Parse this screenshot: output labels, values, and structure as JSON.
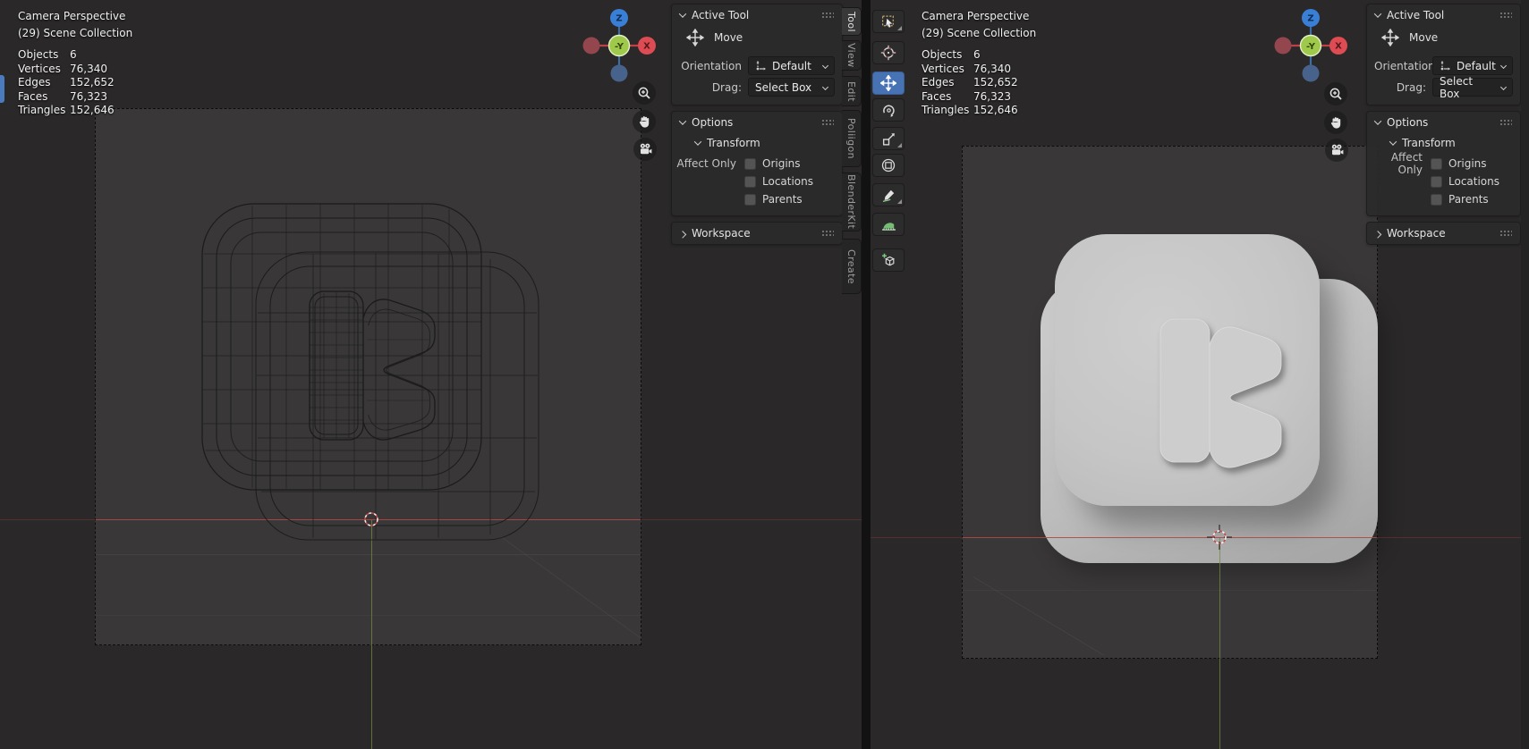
{
  "viewport": {
    "view_name": "Camera Perspective",
    "collection": "(29) Scene Collection",
    "stats": [
      {
        "label": "Objects",
        "value": "6"
      },
      {
        "label": "Vertices",
        "value": "76,340"
      },
      {
        "label": "Edges",
        "value": "152,652"
      },
      {
        "label": "Faces",
        "value": "76,323"
      },
      {
        "label": "Triangles",
        "value": "152,646"
      }
    ],
    "gizmo": {
      "z": "Z",
      "x": "X",
      "front": "-Y"
    }
  },
  "panel": {
    "active_tool": {
      "title": "Active Tool",
      "tool_name": "Move",
      "orientation_label": "Orientation",
      "orientation_value": "Default",
      "drag_label": "Drag:",
      "drag_value": "Select Box"
    },
    "options": {
      "title": "Options",
      "transform_title": "Transform",
      "affect_only_label": "Affect Only",
      "checkboxes": [
        {
          "label": "Origins",
          "checked": false
        },
        {
          "label": "Locations",
          "checked": false
        },
        {
          "label": "Parents",
          "checked": false
        }
      ]
    },
    "workspace": {
      "title": "Workspace"
    }
  },
  "tabs": [
    {
      "label": "Tool",
      "active": true
    },
    {
      "label": "View",
      "active": false
    },
    {
      "label": "Edit",
      "active": false
    },
    {
      "label": "Poliigon",
      "active": false
    },
    {
      "label": "BlenderKit",
      "active": false
    },
    {
      "label": "Create",
      "active": false
    }
  ],
  "toolbar": {
    "tools": [
      {
        "name": "select-box",
        "active": false
      },
      {
        "name": "cursor",
        "active": false
      },
      {
        "name": "move",
        "active": true
      },
      {
        "name": "rotate",
        "active": false
      },
      {
        "name": "scale",
        "active": false
      },
      {
        "name": "transform",
        "active": false
      },
      {
        "name": "annotate",
        "active": false
      },
      {
        "name": "measure",
        "active": false
      },
      {
        "name": "add-cube",
        "active": false
      }
    ]
  },
  "colors": {
    "toolbar_active": "#4772b3",
    "axis_x_ball": "#dd4b53",
    "axis_z_ball": "#3a7fd6",
    "axis_front_ball": "#9fc94a",
    "floor_line_x": "#a34743",
    "floor_line_y": "#6d8f3e",
    "model_gray": "#c8c8c8",
    "viewport_bg": "#2a2828",
    "camera_bg": "#393737"
  }
}
